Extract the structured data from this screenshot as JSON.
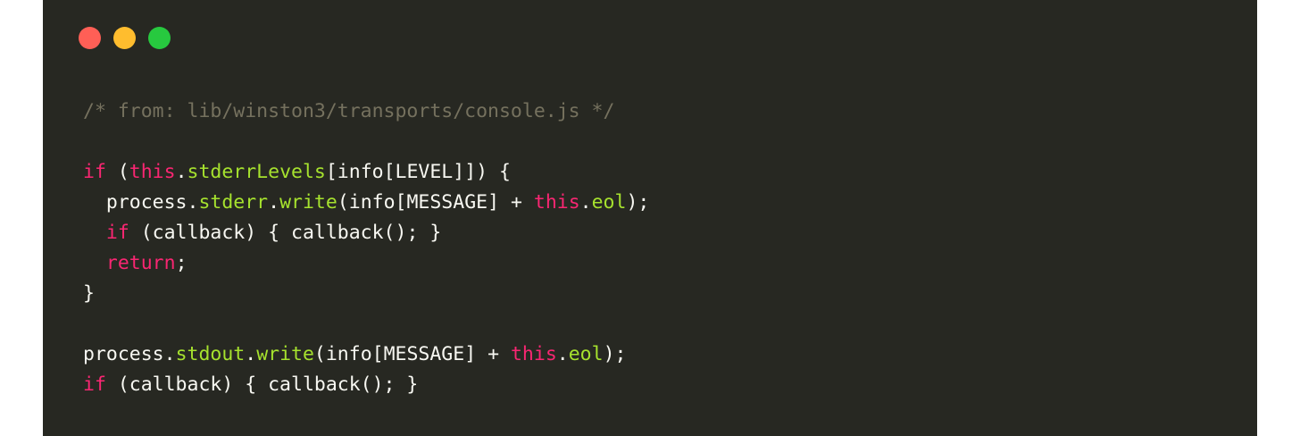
{
  "colors": {
    "background": "#272822",
    "page": "#ffffff",
    "dot_red": "#ff5f56",
    "dot_yellow": "#ffbd2e",
    "dot_green": "#27c93f",
    "plain": "#f8f8f2",
    "comment": "#75715e",
    "keyword": "#f92672",
    "function": "#a6e22e"
  },
  "window_controls": [
    {
      "name": "close",
      "icon": "red-dot-icon"
    },
    {
      "name": "minimize",
      "icon": "yellow-dot-icon"
    },
    {
      "name": "zoom",
      "icon": "green-dot-icon"
    }
  ],
  "code": {
    "language": "javascript",
    "lines": [
      [
        {
          "t": "/* from: lib/winston3/transports/console.js */",
          "k": "comment"
        }
      ],
      [],
      [
        {
          "t": "if",
          "k": "keyword"
        },
        {
          "t": " (",
          "k": "plain"
        },
        {
          "t": "this",
          "k": "keyword"
        },
        {
          "t": ".",
          "k": "plain"
        },
        {
          "t": "stderrLevels",
          "k": "function"
        },
        {
          "t": "[info[LEVEL]]) {",
          "k": "plain"
        }
      ],
      [
        {
          "t": "  process.",
          "k": "plain"
        },
        {
          "t": "stderr",
          "k": "function"
        },
        {
          "t": ".",
          "k": "plain"
        },
        {
          "t": "write",
          "k": "function"
        },
        {
          "t": "(info[MESSAGE] + ",
          "k": "plain"
        },
        {
          "t": "this",
          "k": "keyword"
        },
        {
          "t": ".",
          "k": "plain"
        },
        {
          "t": "eol",
          "k": "function"
        },
        {
          "t": ");",
          "k": "plain"
        }
      ],
      [
        {
          "t": "  ",
          "k": "plain"
        },
        {
          "t": "if",
          "k": "keyword"
        },
        {
          "t": " (callback) { callback(); }",
          "k": "plain"
        }
      ],
      [
        {
          "t": "  ",
          "k": "plain"
        },
        {
          "t": "return",
          "k": "keyword"
        },
        {
          "t": ";",
          "k": "plain"
        }
      ],
      [
        {
          "t": "}",
          "k": "plain"
        }
      ],
      [],
      [
        {
          "t": "process.",
          "k": "plain"
        },
        {
          "t": "stdout",
          "k": "function"
        },
        {
          "t": ".",
          "k": "plain"
        },
        {
          "t": "write",
          "k": "function"
        },
        {
          "t": "(info[MESSAGE] + ",
          "k": "plain"
        },
        {
          "t": "this",
          "k": "keyword"
        },
        {
          "t": ".",
          "k": "plain"
        },
        {
          "t": "eol",
          "k": "function"
        },
        {
          "t": ");",
          "k": "plain"
        }
      ],
      [
        {
          "t": "if",
          "k": "keyword"
        },
        {
          "t": " (callback) { callback(); }",
          "k": "plain"
        }
      ]
    ]
  }
}
